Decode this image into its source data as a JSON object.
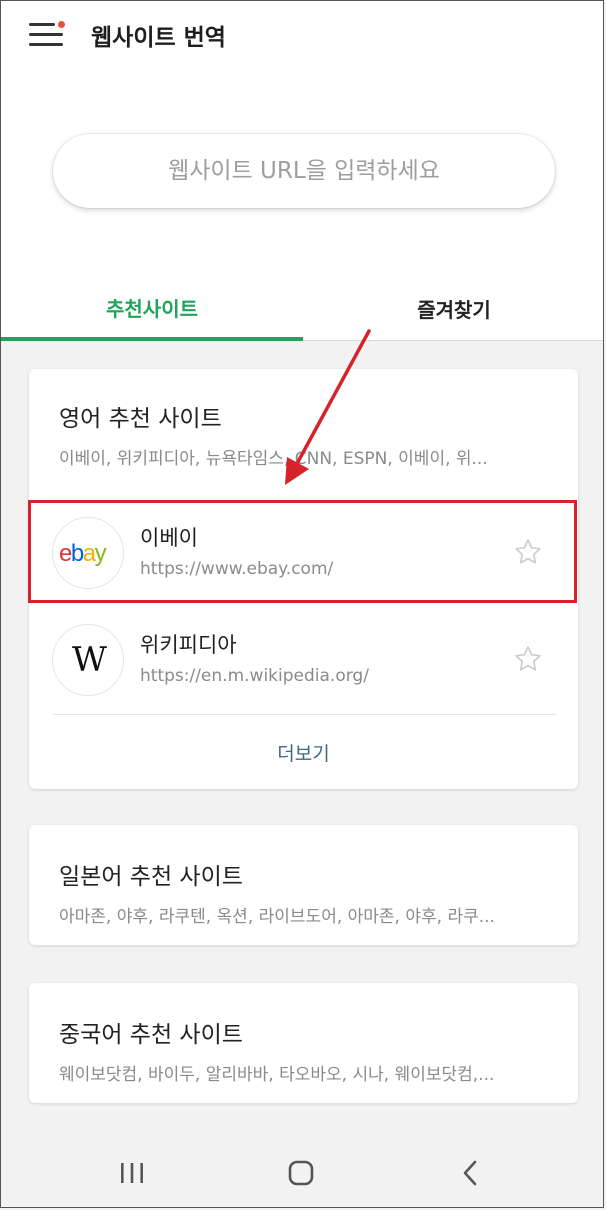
{
  "header": {
    "title": "웹사이트 번역"
  },
  "search": {
    "placeholder": "웹사이트 URL을 입력하세요"
  },
  "tabs": [
    {
      "label": "추천사이트",
      "active": true
    },
    {
      "label": "즐겨찾기",
      "active": false
    }
  ],
  "sections": [
    {
      "title": "영어 추천 사이트",
      "subtitle": "이베이, 위키피디아, 뉴욕타임스, CNN, ESPN, 이베이, 위...",
      "sites": [
        {
          "name": "이베이",
          "url": "https://www.ebay.com/",
          "logo": "ebay-logo"
        },
        {
          "name": "위키피디아",
          "url": "https://en.m.wikipedia.org/",
          "logo": "wikipedia-logo",
          "logo_text": "W"
        }
      ],
      "more_label": "더보기"
    },
    {
      "title": "일본어 추천 사이트",
      "subtitle": "아마존, 야후, 라쿠텐, 옥션, 라이브도어, 아마존, 야후, 라쿠..."
    },
    {
      "title": "중국어 추천 사이트",
      "subtitle": "웨이보닷컴, 바이두, 알리바바, 타오바오, 시나, 웨이보닷컴,..."
    }
  ],
  "logos": {
    "ebay_letters": [
      "e",
      "b",
      "a",
      "y"
    ],
    "ebay_colors": [
      "#e53238",
      "#0064d2",
      "#f5af02",
      "#86b817"
    ]
  },
  "colors": {
    "accent": "#1fa55a",
    "annotation": "#d6222a",
    "more_link": "#3e6a8a"
  },
  "icons": {
    "menu": "hamburger-icon",
    "star": "star-outline-icon",
    "nav_recents": "recents-icon",
    "nav_home": "home-icon",
    "nav_back": "back-icon"
  }
}
